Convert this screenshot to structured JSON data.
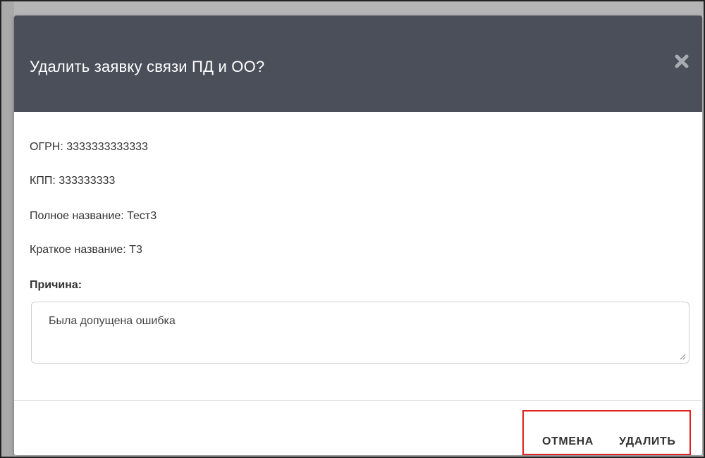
{
  "dialog": {
    "title": "Удалить заявку связи ПД и ОО?",
    "close_icon": "close-icon",
    "colors": {
      "header_bg": "#4a4f59",
      "header_text": "#ffffff",
      "highlight": "#e02020"
    }
  },
  "details": {
    "ogrn": "ОГРН: 3333333333333",
    "kpp": "КПП: 333333333",
    "full_name": "Полное название: Тест3",
    "short_name": "Краткое название: Т3"
  },
  "reason": {
    "label": "Причина:",
    "value": "Была допущена ошибка"
  },
  "footer": {
    "cancel_label": "ОТМЕНА",
    "delete_label": "УДАЛИТЬ"
  }
}
